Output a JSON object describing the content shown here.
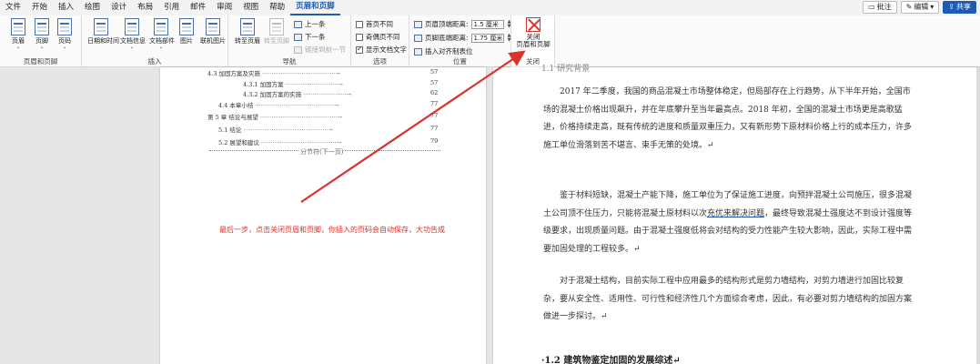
{
  "menubar": {
    "items": [
      "文件",
      "开始",
      "插入",
      "绘图",
      "设计",
      "布局",
      "引用",
      "邮件",
      "审阅",
      "视图",
      "帮助",
      "页眉和页脚"
    ],
    "active_index": 11,
    "right": {
      "comment": "批注",
      "edit": "编辑",
      "share": "共享"
    }
  },
  "ribbon": {
    "groups": {
      "header_footer": {
        "label": "页眉和页脚",
        "buttons": [
          "页眉",
          "页脚",
          "页码"
        ]
      },
      "insert": {
        "label": "插入",
        "buttons": [
          "日期和时间",
          "文档信息",
          "文档部件",
          "图片",
          "联机图片"
        ]
      },
      "navigation": {
        "label": "导航",
        "goto_header": "转至页眉",
        "goto_footer": "转至页脚",
        "prev": "上一条",
        "next": "下一条",
        "link_prev": "链接到前一节"
      },
      "options": {
        "label": "选项",
        "first_page": "首页不同",
        "odd_even": "奇偶页不同",
        "show_text": "显示文档文字"
      },
      "position": {
        "label": "位置",
        "header_top_label": "页眉顶端距离:",
        "header_top_value": "1.5 厘米",
        "footer_bottom_label": "页脚底端距离:",
        "footer_bottom_value": "1.75 厘米",
        "insert_tab": "插入对齐制表位"
      },
      "close": {
        "label": "关闭",
        "button_line1": "关闭",
        "button_line2": "页眉和页脚"
      }
    }
  },
  "left_page": {
    "toc": [
      {
        "text": "4.3 加固方案及实施",
        "page": "57"
      },
      {
        "text": "4.3.1 加固方案",
        "page": "57"
      },
      {
        "text": "4.3.2 加固方案的实施",
        "page": "62"
      },
      {
        "text": "4.4 本章小结",
        "page": "77"
      },
      {
        "text": "第 5 章 结论与展望",
        "page": "77"
      },
      {
        "text": "5.1 结论",
        "page": "77"
      },
      {
        "text": "5.2 展望和建议",
        "page": "79"
      }
    ],
    "section_break": "分节符(下一页)",
    "annotation": "最后一步，点击关闭页眉和页脚，你插入的页码会自动保存，大功告成"
  },
  "right_page": {
    "top_heading": "1.1 研究背景",
    "p1": "2017 年二季度，我国的商品混凝土市场整体稳定，但局部存在上行趋势，从下半年开始，全国市场的混凝土价格出现飙升，并在年底攀升至当年最高点。2018 年初，全国的混凝土市场更是高歌猛进，价格持续走高，既有传统的进度和质量双重压力，又有新形势下原材料价格上行的成本压力，许多施工单位滑落到苦不堪言、束手无策的处境。↵",
    "p2a": "鉴于材料短缺，混凝土产能下降，施工单位为了保证施工进度，向预拌混凝土公司施压，很多混凝土公司顶不住压力，只能将混凝土原材料以次",
    "p2b": "充优来解决问题",
    "p2c": "，最终导致混凝土强度达不到设计强度等级要求，出现质量问题。由于混凝土强度低将会对结构的受力性能产生较大影响，因此，实际工程中需要加固处理的工程较多。↵",
    "p3": "对于混凝土结构，目前实际工程中应用最多的结构形式是剪力墙结构，对剪力墙进行加固比较复杂，要从安全性、适用性、可行性和经济性几个方面综合考虑，因此，有必要对剪力墙结构的加固方案做进一步探讨。↵",
    "h2": "·1.2 建筑物鉴定加固的发展综述↵"
  },
  "colors": {
    "accent": "#1e5cb3",
    "annotation": "#d9342b"
  }
}
